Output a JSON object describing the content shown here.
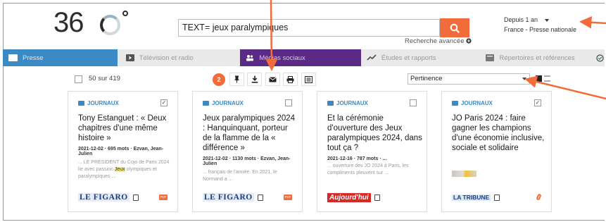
{
  "brand": {
    "digits": "36",
    "name": "360°"
  },
  "search": {
    "query": "TEXT= jeux paralympiques",
    "advanced_label": "Recherche avancée",
    "button_icon": "search-icon"
  },
  "filters": {
    "period": "Depuis 1 an",
    "source": "France - Presse nationale"
  },
  "tabs": [
    {
      "label": "Presse",
      "icon": "newspaper-icon",
      "active": true
    },
    {
      "label": "Télévision et radio",
      "icon": "play-icon"
    },
    {
      "label": "Médias sociaux",
      "icon": "users-icon"
    },
    {
      "label": "Études et rapports",
      "icon": "chart-line-icon"
    },
    {
      "label": "Répertoires et références",
      "icon": "book-icon"
    }
  ],
  "toolbar": {
    "count_text": "50 sur 419",
    "selected_count": "2",
    "actions": [
      "pin-icon",
      "download-icon",
      "mail-icon",
      "print-icon",
      "list-icon"
    ],
    "sort_value": "Pertinence"
  },
  "cards": [
    {
      "type": "JOURNAUX",
      "checked": true,
      "title": "Tony Estanguet : « Deux chapitres d'une même histoire »",
      "meta": "2021-12-02 · 695 mots · Ezvan, Jean-Julien",
      "snippet_before": "... LE PRÉSIDENT du Cojo de Paris 2024 lie avec passion ",
      "snippet_highlight": "Jeux",
      "snippet_after": " olympiques et paralympiques ...",
      "source": "LE FIGARO",
      "attachment": "pdf"
    },
    {
      "type": "JOURNAUX",
      "checked": false,
      "title": "Jeux paralympiques 2024 : Hanquinquant, porteur de la flamme de la « différence »",
      "meta": "2021-12-02 · 1130 mots · Ezvan, Jean-Julien",
      "snippet_before": "... français de l'année. En 2021, le Normand a ...",
      "snippet_highlight": "",
      "snippet_after": "",
      "source": "LE FIGARO",
      "attachment": "pdf"
    },
    {
      "type": "JOURNAUX",
      "checked": false,
      "title": "Et la cérémonie d'ouverture des Jeux paralympiques 2024, dans tout ça ?",
      "meta": "2021-12-16 · 787 mots · ...",
      "snippet_before": "... ouverture des JO 2024 à Paris, les compliments pleuvent sur ...",
      "snippet_highlight": "",
      "snippet_after": "",
      "source": "Aujourd'hui",
      "attachment": "none"
    },
    {
      "type": "JOURNAUX",
      "checked": true,
      "title": "JO Paris 2024 : faire gagner les champions d'une économie inclusive, sociale et solidaire",
      "meta": "",
      "snippet_before": "",
      "snippet_highlight": "",
      "snippet_after": "",
      "source": "LA TRIBUNE",
      "attachment": "clip"
    }
  ],
  "colors": {
    "accent": "#f26b3a",
    "presse_tab": "#3a8ac5",
    "social_tab": "#5a2a86",
    "highlight": "#f3ec7c"
  }
}
